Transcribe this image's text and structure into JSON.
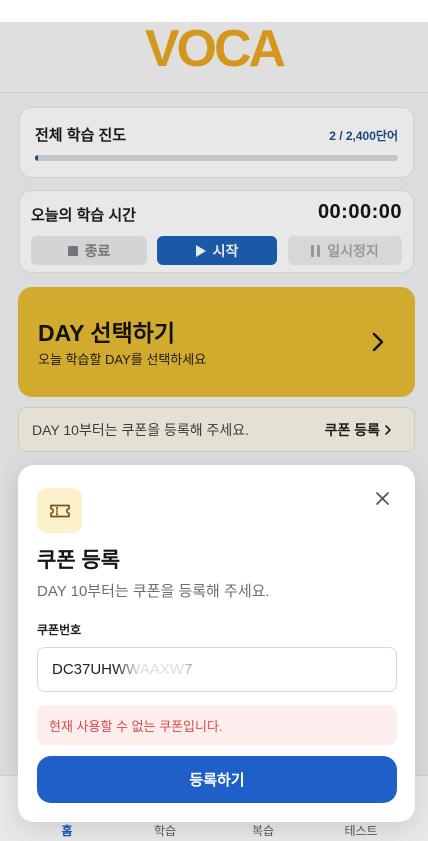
{
  "app": {
    "logo": "VOCA"
  },
  "progress": {
    "title": "전체 학습 진도",
    "value_text": "2 / 2,400단어",
    "current": 2,
    "total": 2400
  },
  "timer": {
    "title": "오늘의 학습 시간",
    "time": "00:00:00",
    "stop_label": "종료",
    "start_label": "시작",
    "pause_label": "일시정지"
  },
  "day_banner": {
    "title": "DAY 선택하기",
    "subtitle": "오늘 학습할 DAY를 선택하세요"
  },
  "coupon_notice": {
    "text": "DAY 10부터는 쿠폰을 등록해 주세요.",
    "link_label": "쿠폰 등록"
  },
  "modal": {
    "title": "쿠폰 등록",
    "subtitle": "DAY 10부터는 쿠폰을 등록해 주세요.",
    "field_label": "쿠폰번호",
    "coupon_code": "DC37UHWWAAXW7",
    "error": "현재 사용할 수 없는 쿠폰입니다.",
    "submit_label": "등록하기"
  },
  "tabs": [
    {
      "label": "홈",
      "active": true
    },
    {
      "label": "학습",
      "active": false
    },
    {
      "label": "복습",
      "active": false
    },
    {
      "label": "테스트",
      "active": false
    }
  ],
  "icons": {
    "stop": "stop-icon",
    "start": "play-icon",
    "pause": "pause-icon",
    "banner_chevron": "chevron-right-icon",
    "notice_chevron": "chevron-right-small-icon",
    "modal_badge": "ticket-icon",
    "close": "close-icon"
  },
  "colors": {
    "logo": "#e9a620",
    "accent_blue": "#1f5fc7",
    "progress_text": "#1f4e8c",
    "banner_yellow": "#e7bb33",
    "error_text": "#d94848",
    "error_bg": "#fdeeee",
    "ticket_badge_bg": "#fdf1cc"
  }
}
